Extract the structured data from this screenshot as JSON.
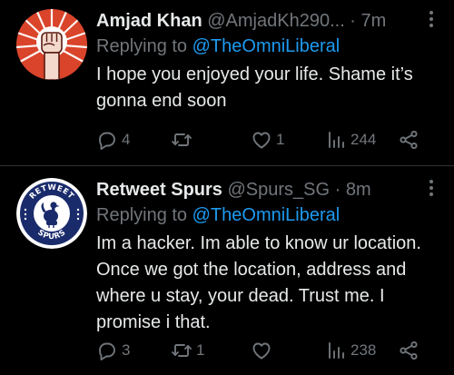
{
  "tweets": [
    {
      "name": "Amjad Khan",
      "meta": "@AmjadKh290... · 7m",
      "reply_prefix": "Replying to ",
      "reply_handle": "@TheOmniLiberal",
      "body": "I hope you enjoyed your life. Shame it’s gonna end soon",
      "replies": "4",
      "retweets": "",
      "likes": "1",
      "views": "244",
      "avatar": "raised-fist-sunburst"
    },
    {
      "name": "Retweet Spurs",
      "meta": "@Spurs_SG · 8m",
      "reply_prefix": "Replying to ",
      "reply_handle": "@TheOmniLiberal",
      "body": "Im a hacker. Im able to know ur location. Once we got the location, address and where u stay, your dead. Trust me. I promise i that.",
      "replies": "3",
      "retweets": "1",
      "likes": "",
      "views": "238",
      "avatar": "spurs-cockerel-badge",
      "avatar_text_top": "RETWEET",
      "avatar_text_bottom": "SPURS"
    }
  ],
  "colors": {
    "background": "#000000",
    "text": "#e7e9ea",
    "muted": "#71767b",
    "link": "#1d9bf0",
    "divider": "#2f3336",
    "avatar1_bg": "#d9442a",
    "avatar2_bg": "#ffffff",
    "avatar2_ring": "#1a2b6b"
  },
  "icons": [
    "reply-icon",
    "retweet-icon",
    "like-icon",
    "views-icon",
    "share-icon",
    "more-icon"
  ]
}
